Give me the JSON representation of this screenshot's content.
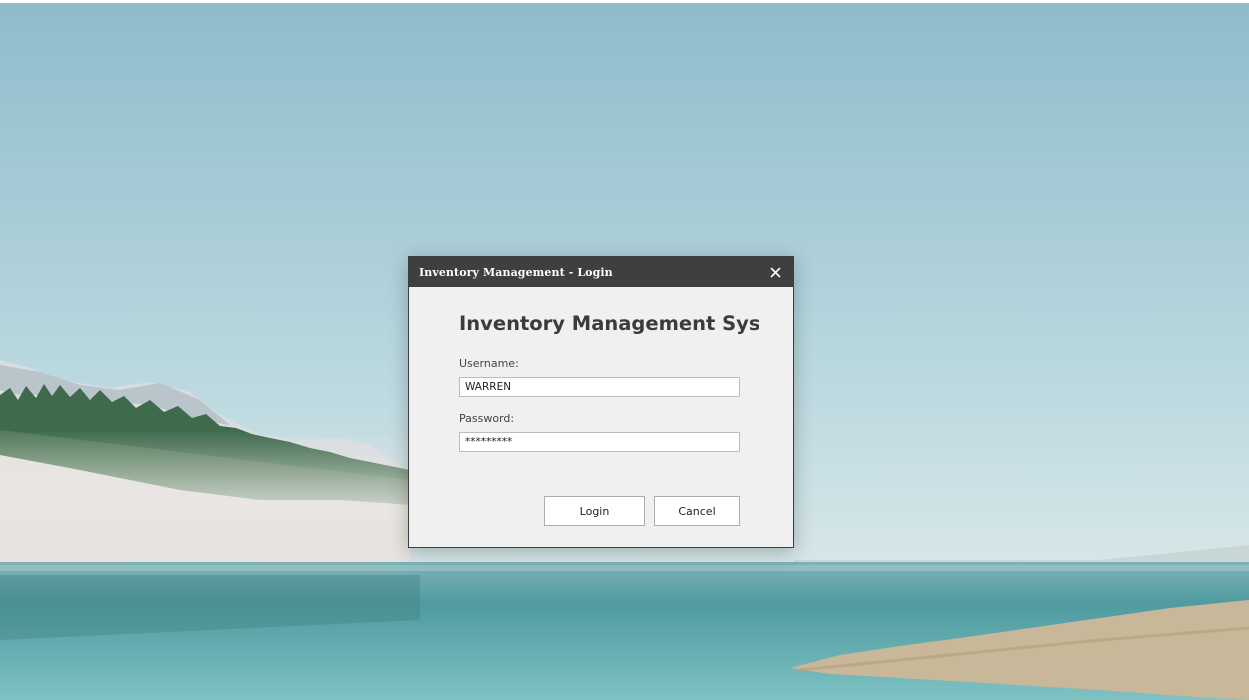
{
  "dialog": {
    "title": "Inventory Management - Login",
    "heading": "Inventory Management System",
    "username_label": "Username:",
    "username_value": "WARREN",
    "password_label": "Password:",
    "password_value": "*********",
    "login_label": "Login",
    "cancel_label": "Cancel",
    "close_icon": "close-icon"
  },
  "colors": {
    "titlebar": "#3f3f3f",
    "dialog_bg": "#f0f0f0",
    "sky_top": "#8fbccb",
    "water": "#5fa7a8"
  }
}
